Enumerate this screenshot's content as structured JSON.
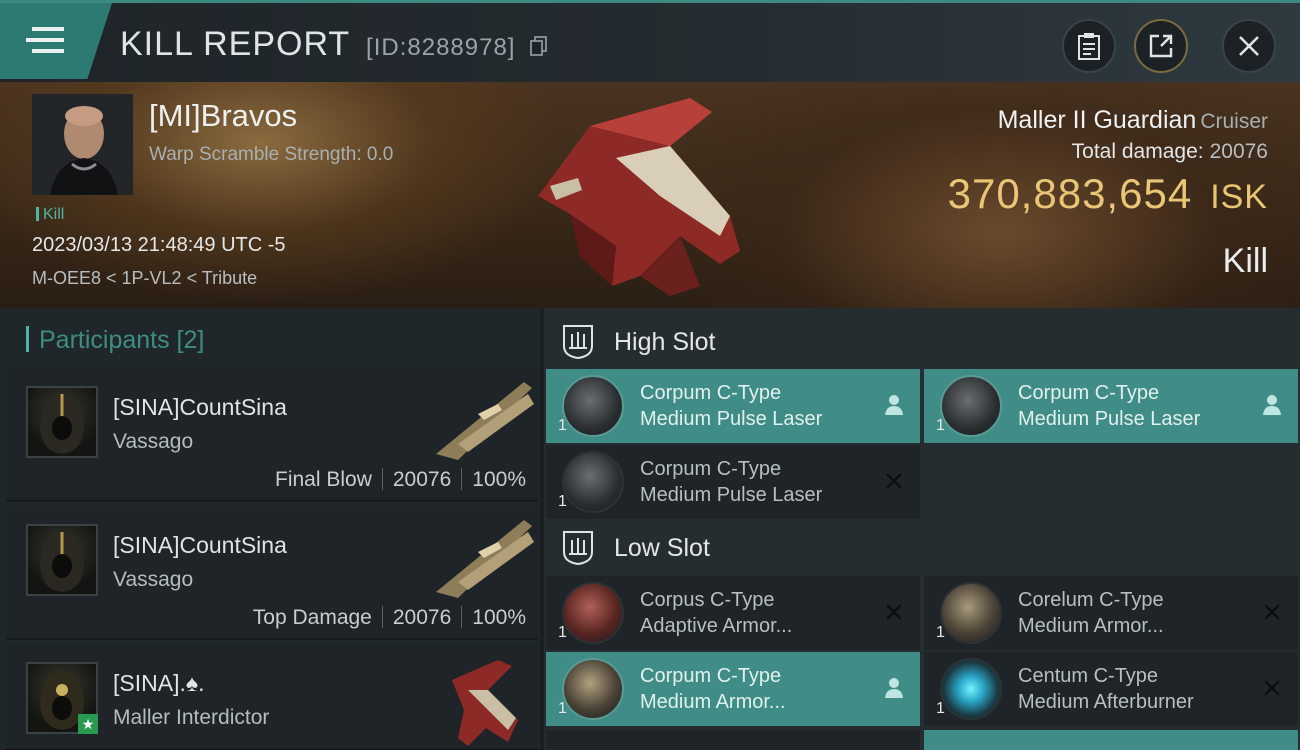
{
  "header": {
    "title": "KILL REPORT",
    "report_id": "[ID:8288978]"
  },
  "victim": {
    "name": "[MI]Bravos",
    "warp_scramble": "Warp Scramble Strength: 0.0",
    "tag": "Kill",
    "datetime": "2023/03/13 21:48:49 UTC -5",
    "location": "M-OEE8 < 1P-VL2 < Tribute",
    "ship_name": "Maller II Guardian",
    "ship_class": "Cruiser",
    "total_damage_label": "Total damage:",
    "total_damage": "20076",
    "isk_value": "370,883,654",
    "isk_unit": "ISK",
    "result": "Kill"
  },
  "participants": {
    "label": "Participants [2]",
    "items": [
      {
        "name": "[SINA]CountSina",
        "ship": "Vassago",
        "role": "Final Blow",
        "damage": "20076",
        "percent": "100%"
      },
      {
        "name": "[SINA]CountSina",
        "ship": "Vassago",
        "role": "Top Damage",
        "damage": "20076",
        "percent": "100%"
      },
      {
        "name": "[SINA].♠.",
        "ship": "Maller Interdictor",
        "role": "",
        "damage": "",
        "percent": ""
      }
    ]
  },
  "slots": {
    "high": {
      "label": "High Slot",
      "modules": [
        {
          "line1": "Corpum C-Type",
          "line2": "Medium Pulse Laser",
          "qty": "1",
          "status": "person-icon",
          "highlight": true
        },
        {
          "line1": "Corpum C-Type",
          "line2": "Medium Pulse Laser",
          "qty": "1",
          "status": "person-icon",
          "highlight": true
        },
        {
          "line1": "Corpum C-Type",
          "line2": "Medium Pulse Laser",
          "qty": "1",
          "status": "destroyed-x-icon",
          "highlight": false
        }
      ]
    },
    "low": {
      "label": "Low Slot",
      "modules": [
        {
          "line1": "Corpus C-Type",
          "line2": "Adaptive Armor...",
          "qty": "1",
          "status": "destroyed-x-icon",
          "highlight": false
        },
        {
          "line1": "Corelum C-Type",
          "line2": "Medium Armor...",
          "qty": "1",
          "status": "destroyed-x-icon",
          "highlight": false
        },
        {
          "line1": "Corpum C-Type",
          "line2": "Medium Armor...",
          "qty": "1",
          "status": "person-icon",
          "highlight": true
        },
        {
          "line1": "Centum C-Type",
          "line2": "Medium Afterburner",
          "qty": "1",
          "status": "destroyed-x-icon",
          "highlight": false
        }
      ]
    }
  },
  "colors": {
    "accent_teal": "#3f8d86",
    "isk_gold": "#e8c676"
  }
}
